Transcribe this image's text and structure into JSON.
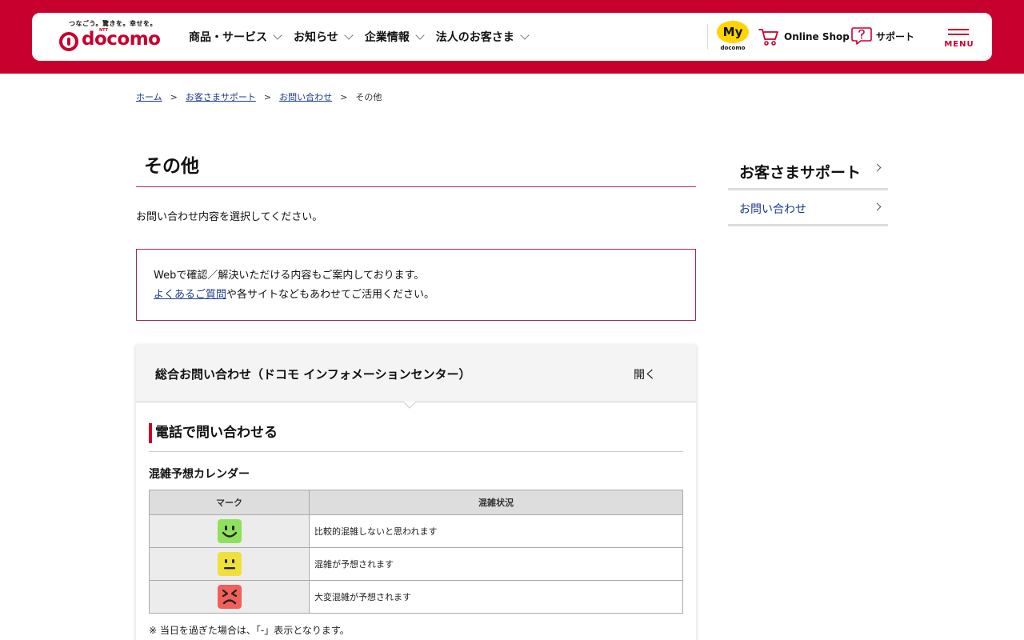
{
  "header": {
    "logo_tagline": "つなごう。驚きを。幸せを。",
    "logo_ntt": "NTT",
    "logo_word": "docomo",
    "nav": [
      {
        "label": "商品・サービス"
      },
      {
        "label": "お知らせ"
      },
      {
        "label": "企業情報"
      },
      {
        "label": "法人のお客さま"
      }
    ],
    "mydocomo_badge": "My",
    "mydocomo_sub": "docomo",
    "online_shop": "Online Shop",
    "support": "サポート",
    "menu": "MENU"
  },
  "breadcrumb": {
    "items": [
      "ホーム",
      "お客さまサポート",
      "お問い合わせ"
    ],
    "current": "その他",
    "separator": ">"
  },
  "main": {
    "title": "その他",
    "lead": "お問い合わせ内容を選択してください。",
    "notice_line1": "Webで確認／解決いただける内容もご案内しております。",
    "notice_link": "よくあるご質問",
    "notice_line2_rest": "や各サイトなどもあわせてご活用ください。",
    "accordion": {
      "title": "総合お問い合わせ（ドコモ インフォメーションセンター）",
      "toggle": "開く",
      "section_heading": "電話で問い合わせる",
      "calendar_title": "混雑予想カレンダー",
      "table_headers": [
        "マーク",
        "混雑状況"
      ],
      "rows": [
        {
          "icon": "smile-face-icon",
          "color": "#8fe05a",
          "desc": "比較的混雑しないと思われます"
        },
        {
          "icon": "neutral-face-icon",
          "color": "#f0e03a",
          "desc": "混雑が予想されます"
        },
        {
          "icon": "distressed-face-icon",
          "color": "#f0605a",
          "desc": "大変混雑が予想されます"
        }
      ],
      "note": "※ 当日を過ぎた場合は、「-」表示となります。"
    }
  },
  "sidebar": {
    "title": "お客さまサポート",
    "link": "お問い合わせ"
  },
  "colors": {
    "brand_red": "#c8002e",
    "accent_border": "#a3265c",
    "link_blue": "#1a3a8c"
  }
}
